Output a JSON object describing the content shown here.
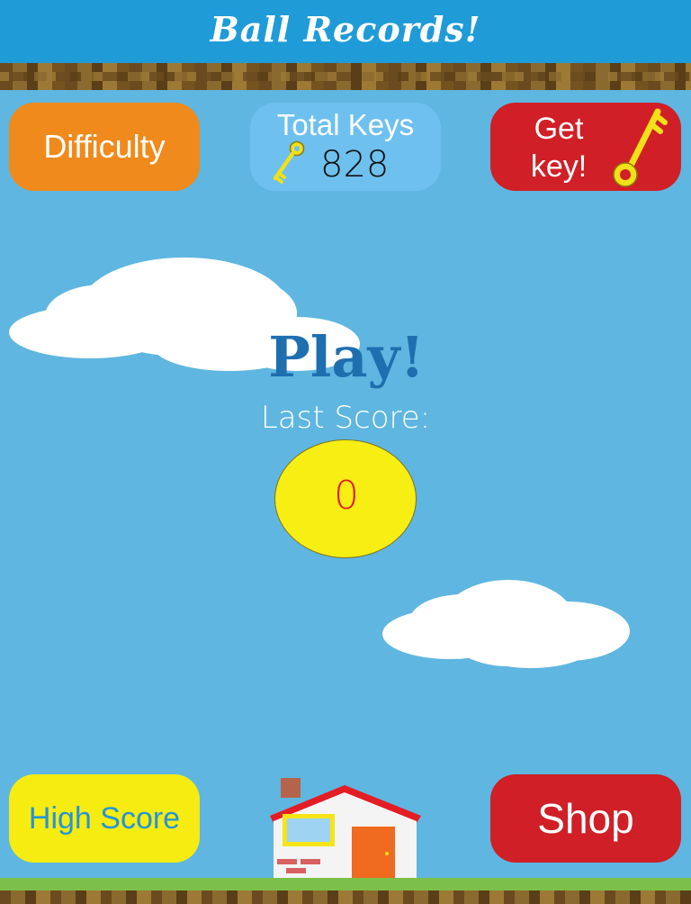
{
  "header": {
    "title": "Ball Records!"
  },
  "buttons": {
    "difficulty": "Difficulty",
    "get_key_line1": "Get",
    "get_key_line2": "key!",
    "high_score": "High Score",
    "shop": "Shop"
  },
  "keys": {
    "label": "Total Keys",
    "count": "828"
  },
  "main": {
    "play": "Play!",
    "last_score_label": "Last Score:",
    "last_score_value": "0"
  },
  "icons": {
    "keys_panel": "key-icon",
    "get_key": "key-icon",
    "home": "house-icon"
  },
  "colors": {
    "sky": "#5fb6e0",
    "header": "#1f9bd8",
    "difficulty": "#f08a1c",
    "keys_panel": "#6ec0ee",
    "red_button": "#d01f26",
    "yellow": "#f6ec12",
    "play_text": "#1e6fb0",
    "score_text": "#e02020",
    "grass": "#7cc04a"
  }
}
